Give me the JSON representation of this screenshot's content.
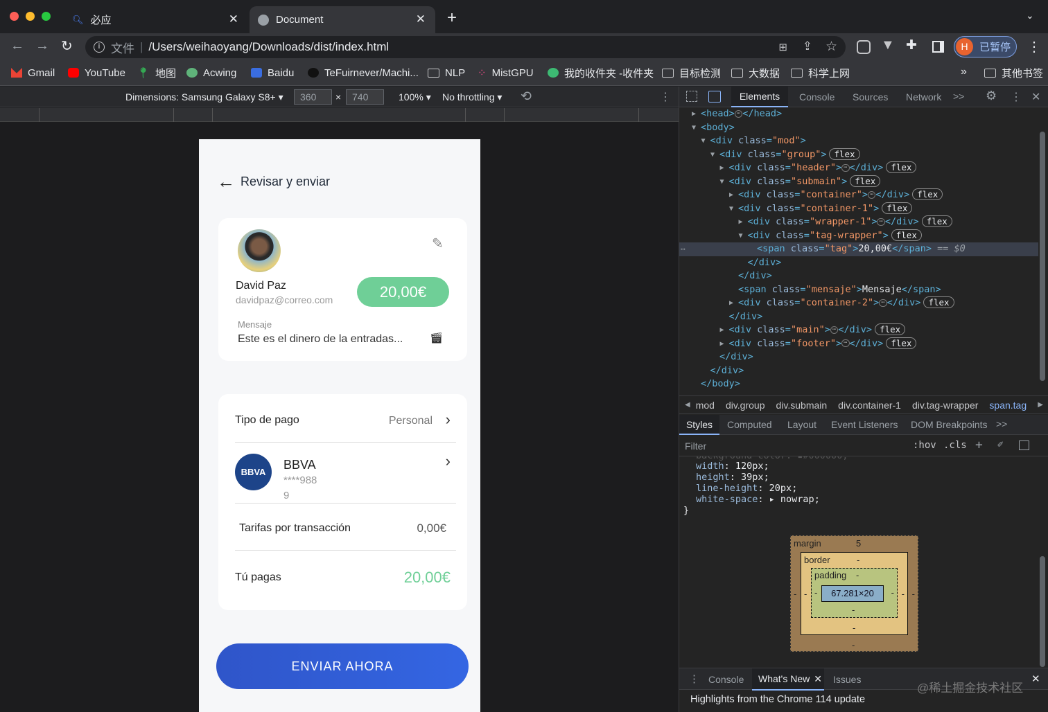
{
  "browser": {
    "tabs": [
      {
        "title": "必应",
        "icon": "bing-search-icon"
      },
      {
        "title": "Document",
        "icon": "globe-icon"
      }
    ],
    "new_tab": "+",
    "url_prefix": "文件",
    "url": "/Users/weihaoyang/Downloads/dist/index.html",
    "profile_initial": "H",
    "profile_status": "已暂停",
    "bookmarks": [
      "Gmail",
      "YouTube",
      "地图",
      "Acwing",
      "Baidu",
      "TeFuirnever/Machi...",
      "NLP",
      "MistGPU",
      "我的收件夹 -收件夹",
      "目标检测",
      "大数据",
      "科学上网"
    ],
    "bookmarks_more": "»",
    "other_bookmarks": "其他书签"
  },
  "device_toolbar": {
    "dimensions_label": "Dimensions: Samsung Galaxy S8+",
    "width": "360",
    "times": "×",
    "height": "740",
    "zoom": "100%",
    "throttling": "No throttling"
  },
  "app": {
    "header_title": "Revisar y enviar",
    "recipient": {
      "name": "David Paz",
      "email": "davidpaz@correo.com",
      "amount": "20,00€",
      "message_label": "Mensaje",
      "message_text": "Este es el dinero de la entradas..."
    },
    "payment": {
      "type_label": "Tipo de pago",
      "type_value": "Personal",
      "bank_logo": "BBVA",
      "bank_name": "BBVA",
      "account_line1": "****988",
      "account_line2": "9",
      "fee_label": "Tarifas por transacción",
      "fee_value": "0,00€",
      "total_label": "Tú pagas",
      "total_value": "20,00€"
    },
    "send_button": "ENVIAR AHORA",
    "colors": {
      "accent_green": "#6fcf97",
      "button_blue": "#2f5fd6",
      "bbva_blue": "#1d4489"
    }
  },
  "devtools": {
    "tabs": [
      "Elements",
      "Console",
      "Sources",
      "Network"
    ],
    "more": ">>",
    "dom": [
      {
        "indent": 0,
        "arrow": "▶",
        "html": "<head>",
        "ell": true,
        "close": "</head>",
        "flex": false
      },
      {
        "indent": 0,
        "arrow": "▼",
        "html": "<body>",
        "flex": false
      },
      {
        "indent": 1,
        "arrow": "▼",
        "tagn": "div",
        "cls": "mod",
        "flex": false
      },
      {
        "indent": 2,
        "arrow": "▼",
        "tagn": "div",
        "cls": "group",
        "flex": true
      },
      {
        "indent": 3,
        "arrow": "▶",
        "tagn": "div",
        "cls": "header",
        "ell": true,
        "flex": true
      },
      {
        "indent": 3,
        "arrow": "▼",
        "tagn": "div",
        "cls": "submain",
        "flex": true
      },
      {
        "indent": 4,
        "arrow": "▶",
        "tagn": "div",
        "cls": "container",
        "ell": true,
        "flex": true
      },
      {
        "indent": 4,
        "arrow": "▼",
        "tagn": "div",
        "cls": "container-1",
        "flex": true
      },
      {
        "indent": 5,
        "arrow": "▶",
        "tagn": "div",
        "cls": "wrapper-1",
        "ell": true,
        "flex": true
      },
      {
        "indent": 5,
        "arrow": "▼",
        "tagn": "div",
        "cls": "tag-wrapper",
        "flex": true
      },
      {
        "indent": 6,
        "arrow": "",
        "tagn": "span",
        "cls": "tag",
        "text": "20,00€",
        "selected": true
      },
      {
        "indent": 5,
        "arrow": "",
        "html": "</div>"
      },
      {
        "indent": 4,
        "arrow": "",
        "html": "</div>"
      },
      {
        "indent": 4,
        "arrow": "",
        "tagn": "span",
        "cls": "mensaje",
        "text": "Mensaje"
      },
      {
        "indent": 4,
        "arrow": "▶",
        "tagn": "div",
        "cls": "container-2",
        "ell": true,
        "flex": true
      },
      {
        "indent": 3,
        "arrow": "",
        "html": "</div>"
      },
      {
        "indent": 3,
        "arrow": "▶",
        "tagn": "div",
        "cls": "main",
        "ell": true,
        "flex": true
      },
      {
        "indent": 3,
        "arrow": "▶",
        "tagn": "div",
        "cls": "footer",
        "ell": true,
        "flex": true
      },
      {
        "indent": 2,
        "arrow": "",
        "html": "</div>"
      },
      {
        "indent": 1,
        "arrow": "",
        "html": "</div>"
      },
      {
        "indent": 0,
        "arrow": "",
        "html": "</body>"
      }
    ],
    "flex_badge": "flex",
    "selected_suffix": "== $0",
    "breadcrumbs": [
      "mod",
      "div.group",
      "div.submain",
      "div.container-1",
      "div.tag-wrapper",
      "span.tag"
    ],
    "style_tabs": [
      "Styles",
      "Computed",
      "Layout",
      "Event Listeners",
      "DOM Breakpoints"
    ],
    "filter_placeholder": "Filter",
    "hov": ":hov",
    "cls": ".cls",
    "css_lines": [
      {
        "prop": "width",
        "val": "120px"
      },
      {
        "prop": "height",
        "val": "39px"
      },
      {
        "prop": "line-height",
        "val": "20px"
      },
      {
        "prop": "white-space",
        "val": "nowrap"
      }
    ],
    "css_close": "}",
    "box": {
      "margin_label": "margin",
      "margin_top": "5",
      "border_label": "border",
      "padding_label": "padding",
      "dash": "-",
      "content": "67.281×20"
    },
    "drawer_tabs": [
      "Console",
      "What's New",
      "Issues"
    ],
    "drawer_text": "Highlights from the Chrome 114 update",
    "watermark": "@稀土掘金技术社区"
  }
}
